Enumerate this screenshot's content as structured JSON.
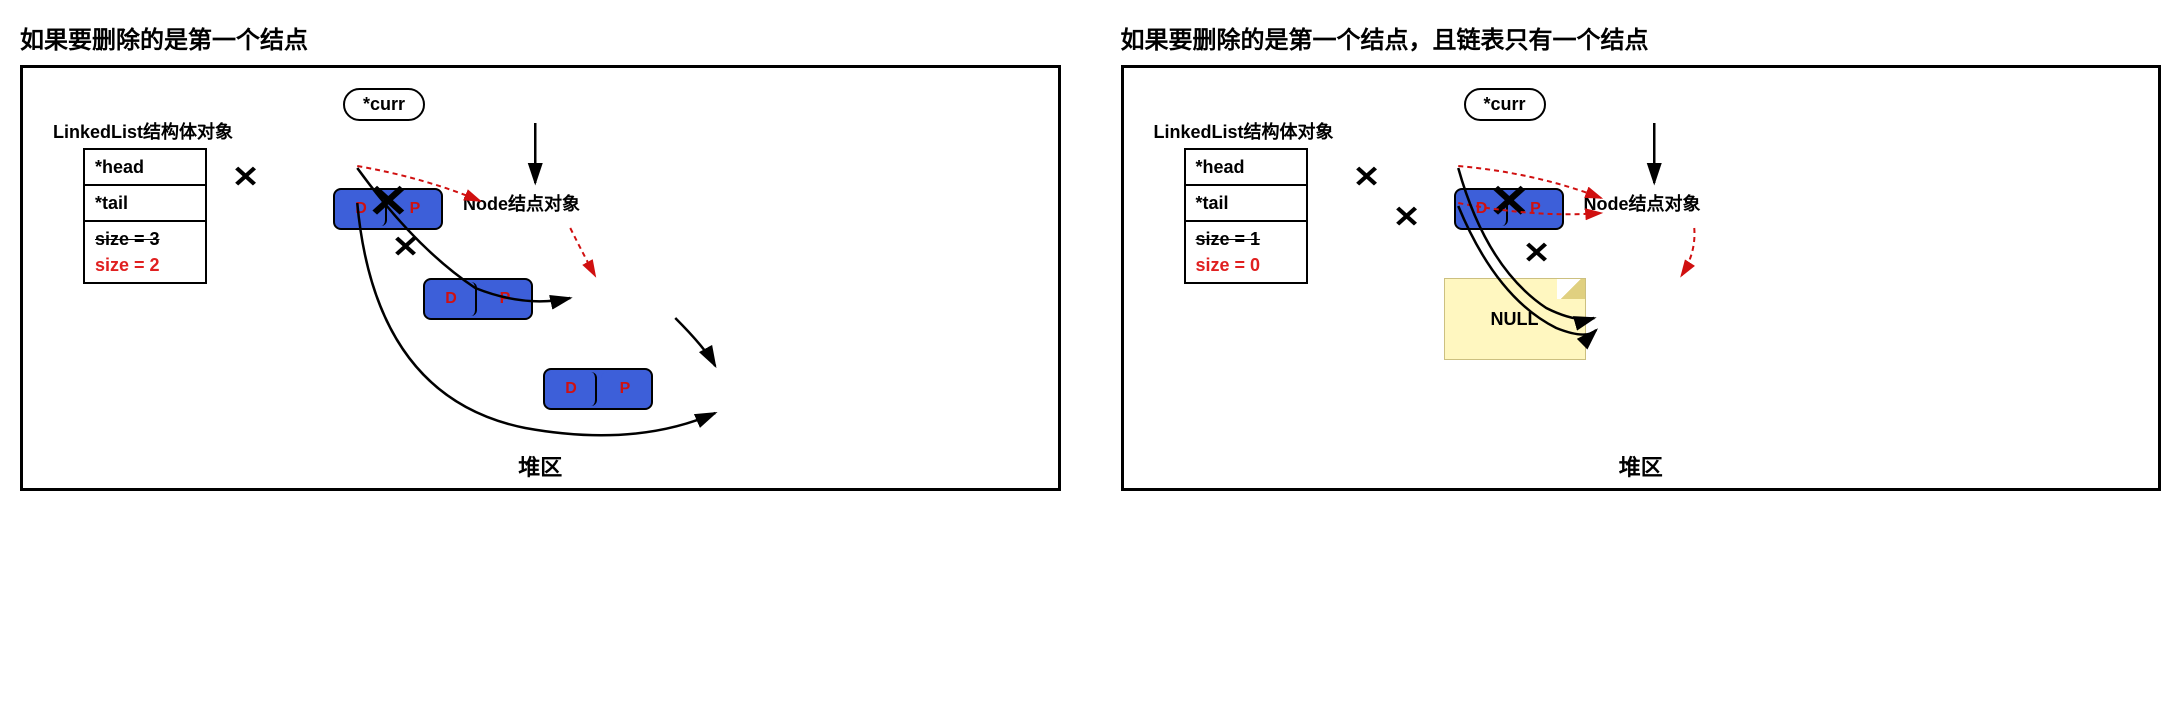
{
  "left": {
    "title": "如果要删除的是第一个结点",
    "struct_label": "LinkedList结构体对象",
    "head": "*head",
    "tail": "*tail",
    "size_old": "size = 3",
    "size_new": "size = 2",
    "curr": "*curr",
    "node_label": "Node结点对象",
    "heap": "堆区",
    "d": "D",
    "p": "P"
  },
  "right": {
    "title": "如果要删除的是第一个结点，且链表只有一个结点",
    "struct_label": "LinkedList结构体对象",
    "head": "*head",
    "tail": "*tail",
    "size_old": "size = 1",
    "size_new": "size = 0",
    "curr": "*curr",
    "node_label": "Node结点对象",
    "null": "NULL",
    "heap": "堆区",
    "d": "D",
    "p": "P"
  }
}
